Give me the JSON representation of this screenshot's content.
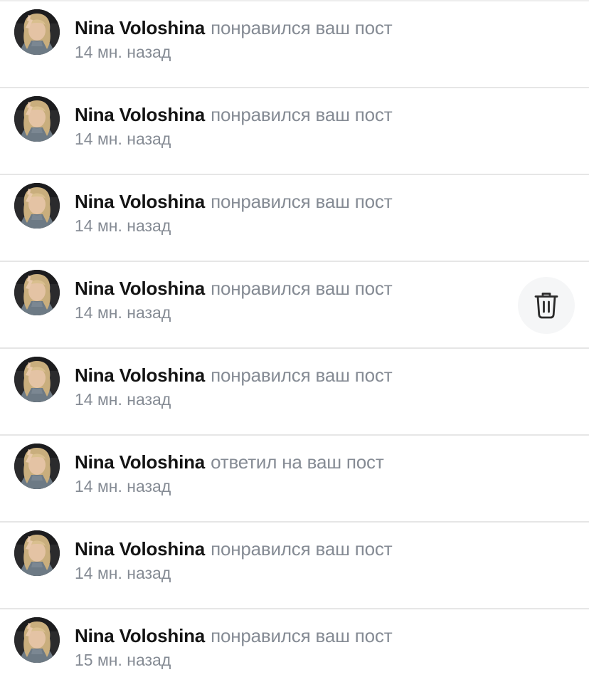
{
  "notifications": [
    {
      "name": "Nina Voloshina",
      "action": "понравился ваш пост",
      "time": "14 мн. назад",
      "has_delete": false
    },
    {
      "name": "Nina Voloshina",
      "action": "понравился ваш пост",
      "time": "14 мн. назад",
      "has_delete": false
    },
    {
      "name": "Nina Voloshina",
      "action": "понравился ваш пост",
      "time": "14 мн. назад",
      "has_delete": false
    },
    {
      "name": "Nina Voloshina",
      "action": "понравился ваш пост",
      "time": "14 мн. назад",
      "has_delete": true
    },
    {
      "name": "Nina Voloshina",
      "action": "понравился ваш пост",
      "time": "14 мн. назад",
      "has_delete": false
    },
    {
      "name": "Nina Voloshina",
      "action": "ответил на ваш пост",
      "time": "14 мн. назад",
      "has_delete": false
    },
    {
      "name": "Nina Voloshina",
      "action": "понравился ваш пост",
      "time": "14 мн. назад",
      "has_delete": false
    },
    {
      "name": "Nina Voloshina",
      "action": "понравился ваш пост",
      "time": "15 мн. назад",
      "has_delete": false
    }
  ],
  "icons": {
    "avatar": "avatar",
    "delete": "trash-icon"
  },
  "colors": {
    "name": "#141414",
    "secondary": "#858b94",
    "divider": "#e6e6e6",
    "delete_bg": "#f5f6f7"
  }
}
